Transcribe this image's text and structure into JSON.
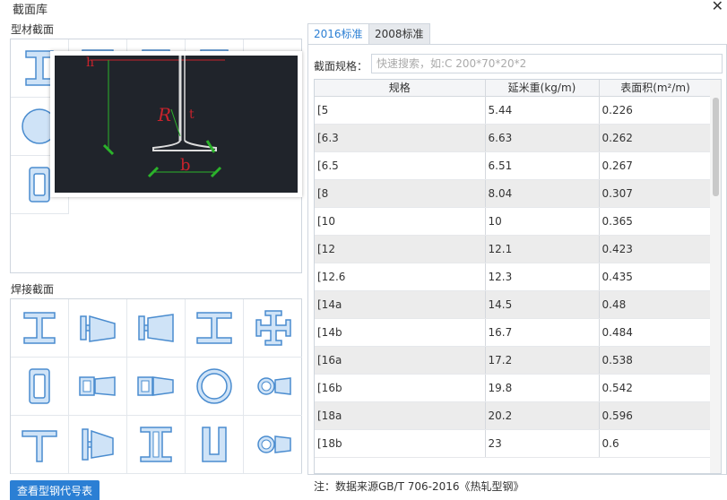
{
  "window": {
    "title": "截面库",
    "close": "✕"
  },
  "profile": {
    "label": "型材截面"
  },
  "welded": {
    "label": "焊接截面"
  },
  "popup": {
    "label_h": "h",
    "label_r": "R",
    "label_t": "t",
    "label_b": "b"
  },
  "tabs": {
    "std2016": "2016标准",
    "std2008": "2008标准"
  },
  "search": {
    "label": "截面规格：",
    "placeholder": "快速搜索，如:C 200*70*20*2"
  },
  "table": {
    "headers": [
      "规格",
      "延米重(kg/m)",
      "表面积(m²/m)"
    ],
    "rows": [
      [
        "[5",
        "5.44",
        "0.226"
      ],
      [
        "[6.3",
        "6.63",
        "0.262"
      ],
      [
        "[6.5",
        "6.51",
        "0.267"
      ],
      [
        "[8",
        "8.04",
        "0.307"
      ],
      [
        "[10",
        "10",
        "0.365"
      ],
      [
        "[12",
        "12.1",
        "0.423"
      ],
      [
        "[12.6",
        "12.3",
        "0.435"
      ],
      [
        "[14a",
        "14.5",
        "0.48"
      ],
      [
        "[14b",
        "16.7",
        "0.484"
      ],
      [
        "[16a",
        "17.2",
        "0.538"
      ],
      [
        "[16b",
        "19.8",
        "0.542"
      ],
      [
        "[18a",
        "20.2",
        "0.596"
      ],
      [
        "[18b",
        "23",
        "0.6"
      ]
    ]
  },
  "note": "注：数据来源GB/T 706-2016《热轧型钢》",
  "button": {
    "label": "查看型钢代号表"
  },
  "colors": {
    "accent": "#2b7fd4",
    "icon_fill": "#cfe3f7",
    "icon_stroke": "#4a8ccf"
  }
}
